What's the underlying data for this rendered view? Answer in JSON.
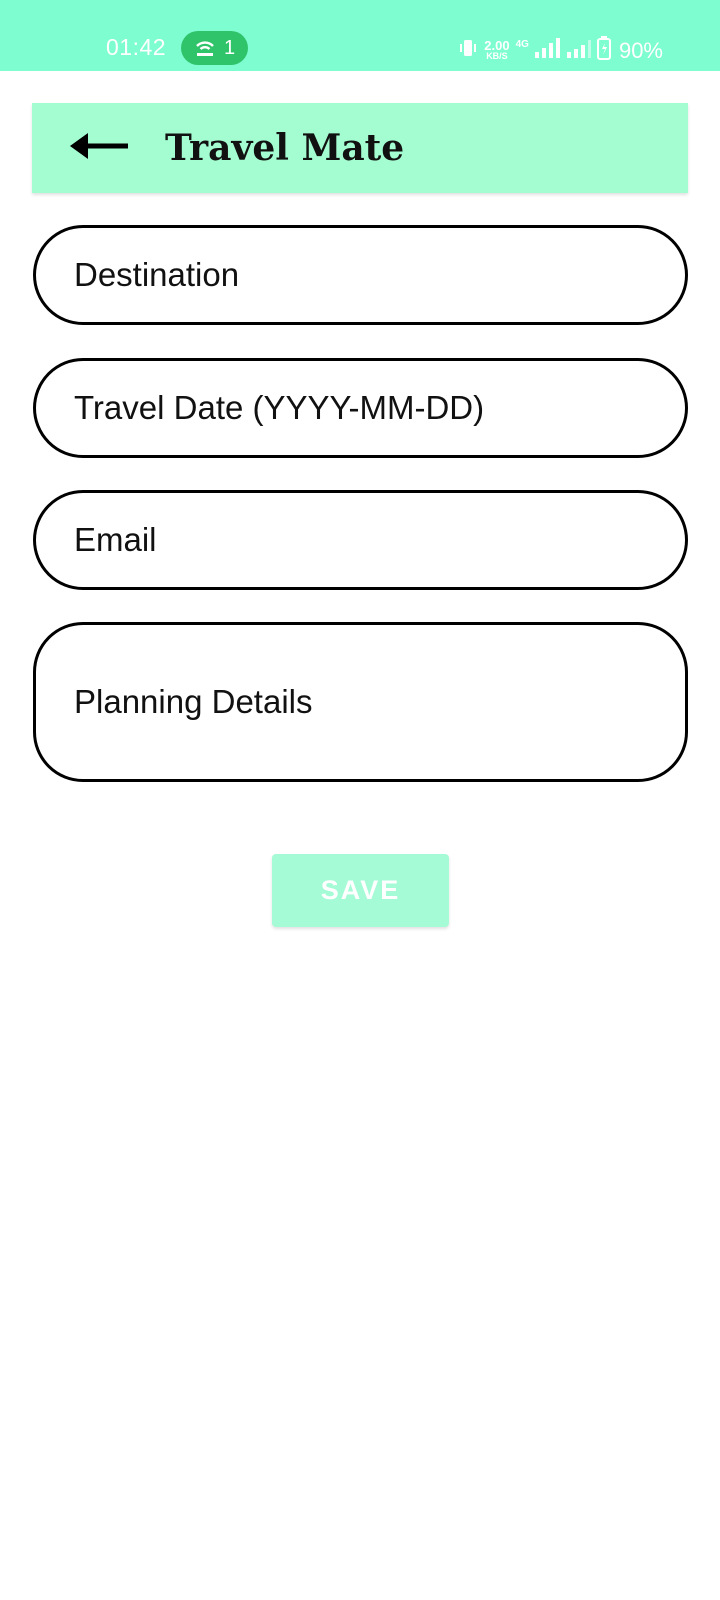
{
  "status_bar": {
    "time": "01:42",
    "hotspot_count": "1",
    "speed_value": "2.00",
    "speed_unit": "KB/S",
    "network": "4G",
    "battery": "90%",
    "background_color": "#7dfdd0"
  },
  "app_bar": {
    "title": "Travel Mate",
    "back_icon": "arrow-left-icon",
    "background_color": "#a3fdd0"
  },
  "form": {
    "destination_placeholder": "Destination",
    "travel_date_placeholder": "Travel Date (YYYY-MM-DD)",
    "email_placeholder": "Email",
    "planning_details_placeholder": "Planning Details",
    "save_label": "SAVE",
    "save_color": "#a5fbd6"
  }
}
